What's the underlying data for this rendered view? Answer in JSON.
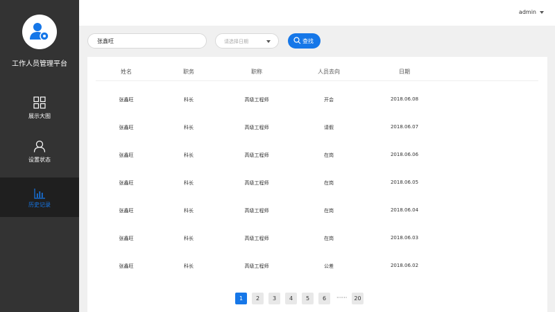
{
  "app": {
    "title": "工作人员管理平台"
  },
  "sidebar": {
    "items": [
      {
        "label": "展示大图",
        "icon": "grid-icon"
      },
      {
        "label": "设置状态",
        "icon": "user-icon"
      },
      {
        "label": "历史记录",
        "icon": "bar-chart-icon",
        "active": true
      }
    ]
  },
  "header": {
    "user": "admin"
  },
  "filters": {
    "name_value": "张鑫旺",
    "date_placeholder": "请选择日期",
    "search_label": "查找"
  },
  "table": {
    "columns": [
      "姓名",
      "职务",
      "职称",
      "人员去向",
      "日期"
    ],
    "rows": [
      [
        "张鑫旺",
        "科长",
        "高级工程师",
        "开会",
        "2018.06.08"
      ],
      [
        "张鑫旺",
        "科长",
        "高级工程师",
        "请假",
        "2018.06.07"
      ],
      [
        "张鑫旺",
        "科长",
        "高级工程师",
        "在岗",
        "2018.06.06"
      ],
      [
        "张鑫旺",
        "科长",
        "高级工程师",
        "在岗",
        "2018.06.05"
      ],
      [
        "张鑫旺",
        "科长",
        "高级工程师",
        "在岗",
        "2018.06.04"
      ],
      [
        "张鑫旺",
        "科长",
        "高级工程师",
        "在岗",
        "2018.06.03"
      ],
      [
        "张鑫旺",
        "科长",
        "高级工程师",
        "公差",
        "2018.06.02"
      ]
    ]
  },
  "pagination": {
    "pages": [
      "1",
      "2",
      "3",
      "4",
      "5",
      "6"
    ],
    "ellipsis": "······",
    "last": "20",
    "current": "1"
  },
  "colors": {
    "accent": "#1677e8",
    "sidebar": "#333333",
    "sidebar_active": "#1f1f1f"
  }
}
